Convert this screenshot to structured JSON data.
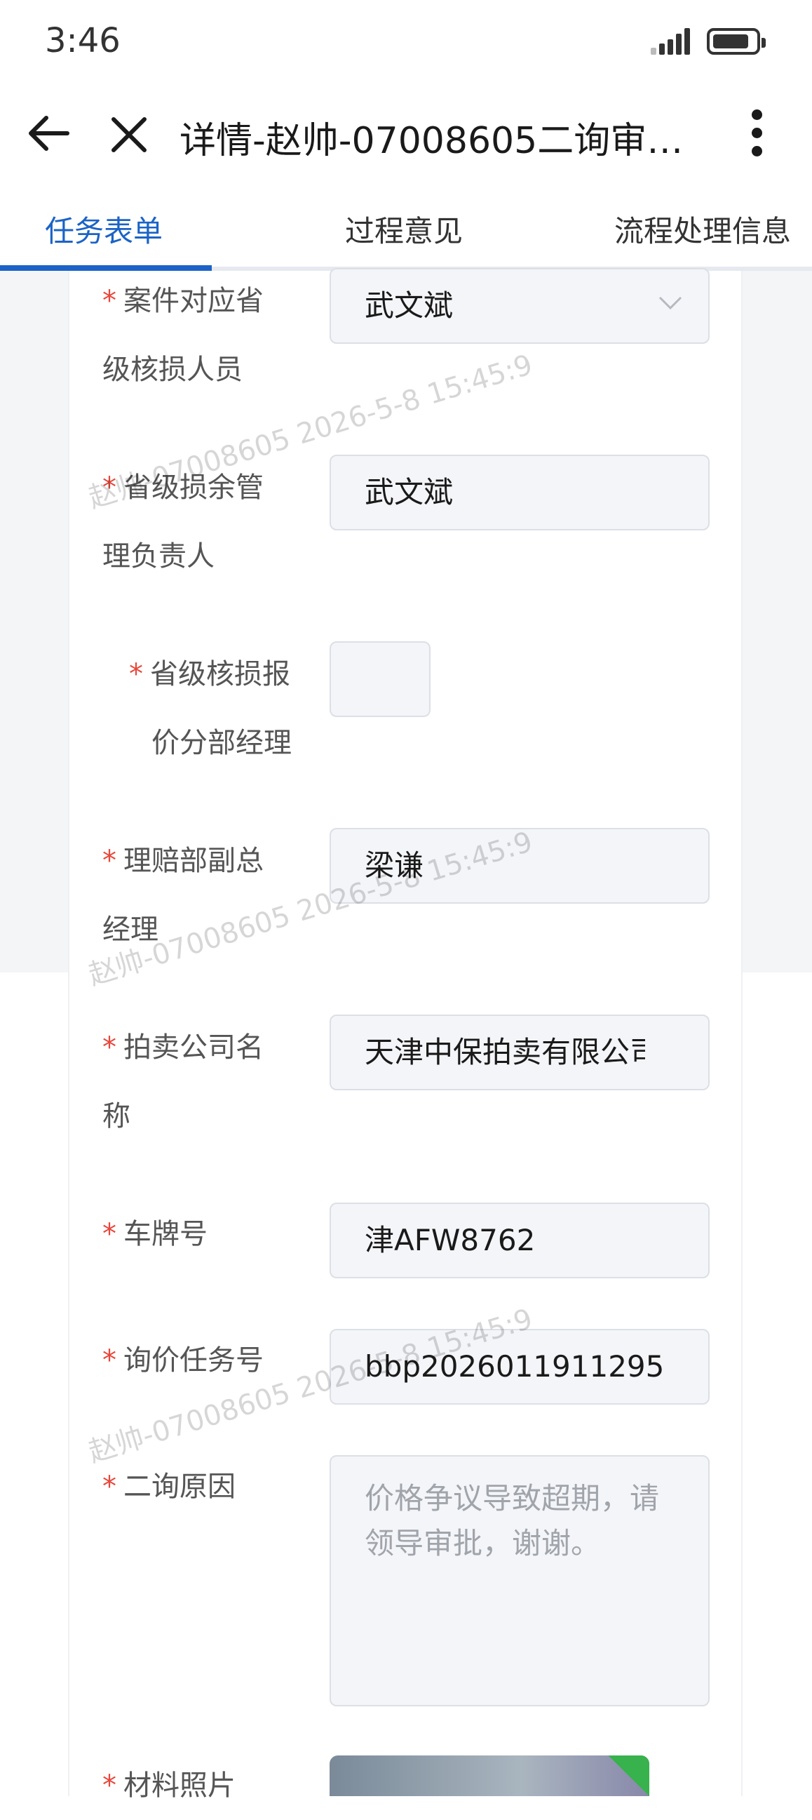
{
  "status_bar": {
    "time": "3:46"
  },
  "header": {
    "title": "详情-赵帅-07008605二询审…"
  },
  "tabs": [
    {
      "label": "任务表单",
      "active": true
    },
    {
      "label": "过程意见",
      "active": false
    },
    {
      "label": "流程处理信息",
      "active": false
    }
  ],
  "form": {
    "required_mark": "*",
    "fields": [
      {
        "label_line1": "案件对应省",
        "label_line2": "级核损人员",
        "value": "武文斌",
        "type": "select"
      },
      {
        "label_line1": "省级损余管",
        "label_line2": "理负责人",
        "value": "武文斌",
        "type": "text"
      },
      {
        "label_line1": "省级核损报",
        "label_line2": "价分部经理",
        "value": "",
        "type": "text"
      },
      {
        "label_line1": "理赔部副总",
        "label_line2": "经理",
        "value": "梁谦",
        "type": "text"
      },
      {
        "label_line1": "拍卖公司名",
        "label_line2": "称",
        "value": "天津中保拍卖有限公司",
        "type": "text"
      },
      {
        "label_line1": "车牌号",
        "label_line2": "",
        "value": "津AFW8762",
        "type": "text"
      },
      {
        "label_line1": "询价任务号",
        "label_line2": "",
        "value": "bbp2026011911295",
        "type": "text"
      },
      {
        "label_line1": "二询原因",
        "label_line2": "",
        "value": "价格争议导致超期，请领导审批，谢谢。",
        "type": "textarea"
      },
      {
        "label_line1": "材料照片",
        "label_line2": "",
        "type": "image"
      }
    ]
  },
  "watermark": {
    "text": "赵帅-07008605  2026-5-8 15:45:9"
  },
  "colors": {
    "accent": "#1b63c6",
    "required": "#e8473a",
    "check": "#37b24d"
  },
  "icons": [
    "back-arrow-icon",
    "close-icon",
    "more-vertical-icon",
    "chevron-down-icon",
    "check-icon",
    "signal-icon",
    "battery-icon"
  ]
}
